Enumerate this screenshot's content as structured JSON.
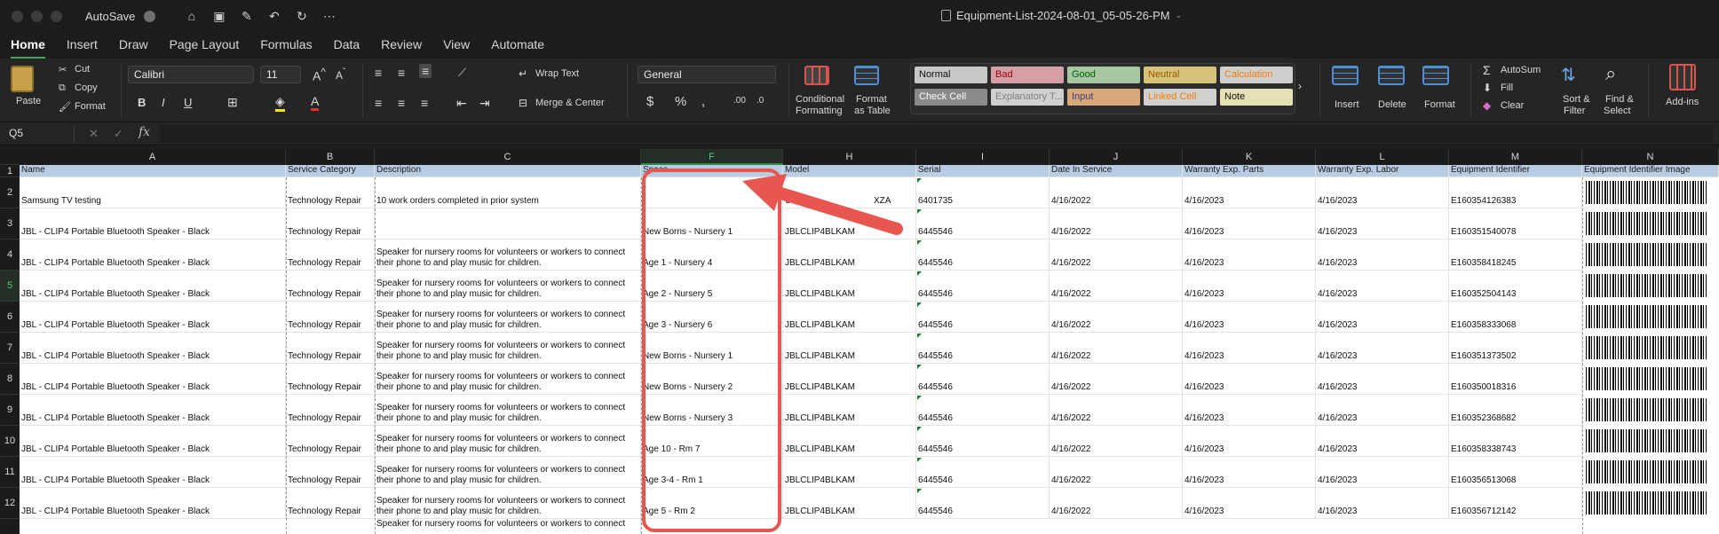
{
  "window": {
    "autosave_label": "AutoSave",
    "title": "Equipment-List-2024-08-01_05-05-26-PM",
    "qat_icons": [
      "home-icon",
      "save-icon",
      "edit-icon",
      "undo-icon",
      "redo-icon",
      "more-icon"
    ]
  },
  "tabs": [
    "Home",
    "Insert",
    "Draw",
    "Page Layout",
    "Formulas",
    "Data",
    "Review",
    "View",
    "Automate"
  ],
  "ribbon": {
    "paste": "Paste",
    "cut": "Cut",
    "copy": "Copy",
    "format": "Format",
    "font_name": "Calibri",
    "font_size": "11",
    "wrap_text": "Wrap Text",
    "merge_center": "Merge & Center",
    "number_format": "General",
    "conditional_formatting": [
      "Conditional",
      "Formatting"
    ],
    "format_as_table": [
      "Format",
      "as Table"
    ],
    "styles": [
      {
        "label": "Normal",
        "bg": "#c8c8c8",
        "fg": "#111111"
      },
      {
        "label": "Bad",
        "bg": "#d4a0a6",
        "fg": "#9c0006"
      },
      {
        "label": "Good",
        "bg": "#a7c7a3",
        "fg": "#006100"
      },
      {
        "label": "Neutral",
        "bg": "#d7c27a",
        "fg": "#9c5700"
      },
      {
        "label": "Calculation",
        "bg": "#cfcfcf",
        "fg": "#fa7d00"
      },
      {
        "label": "Check Cell",
        "bg": "#8a8a8a",
        "fg": "#ffffff"
      },
      {
        "label": "Explanatory T...",
        "bg": "#d0d0d0",
        "fg": "#7f7f7f"
      },
      {
        "label": "Input",
        "bg": "#d7a97a",
        "fg": "#3f3f76"
      },
      {
        "label": "Linked Cell",
        "bg": "#d0d0d0",
        "fg": "#fa7d00"
      },
      {
        "label": "Note",
        "bg": "#e6e1b5",
        "fg": "#111111"
      }
    ],
    "insert": "Insert",
    "delete": "Delete",
    "format_cells": "Format",
    "autosum": "AutoSum",
    "fill": "Fill",
    "clear": "Clear",
    "sort_filter": [
      "Sort &",
      "Filter"
    ],
    "find_select": [
      "Find &",
      "Select"
    ],
    "addins": "Add-ins"
  },
  "formula_bar": {
    "name_box": "Q5",
    "fx": "fx",
    "value": ""
  },
  "sheet": {
    "columns": [
      "A",
      "B",
      "C",
      "F",
      "H",
      "I",
      "J",
      "K",
      "L",
      "M",
      "N"
    ],
    "selected_column": "F",
    "header_row": [
      "Name",
      "Service Category",
      "Description",
      "Space",
      "Model",
      "Serial",
      "Date In Service",
      "Warranty Exp. Parts",
      "Warranty Exp. Labor",
      "Equipment Identifier",
      "Equipment Identifier Image"
    ],
    "rows": [
      {
        "num": "2",
        "cells": [
          "Samsung TV testing",
          "Technology Repair",
          "10 work orders completed in prior system",
          "",
          "UN55",
          "6401735",
          "4/16/2022",
          "4/16/2023",
          "4/16/2023",
          "E160354126383"
        ],
        "model_tail": "XZA"
      },
      {
        "num": "3",
        "cells": [
          "JBL - CLIP4 Portable Bluetooth Speaker - Black",
          "Technology Repair",
          "",
          "New Borns - Nursery 1",
          "JBLCLIP4BLKAM",
          "6445546",
          "4/16/2022",
          "4/16/2023",
          "4/16/2023",
          "E160351540078"
        ]
      },
      {
        "num": "4",
        "cells": [
          "JBL - CLIP4 Portable Bluetooth Speaker - Black",
          "Technology Repair",
          "Speaker for nursery rooms for volunteers or workers to connect their phone to and play music for children.",
          "Age 1 - Nursery 4",
          "JBLCLIP4BLKAM",
          "6445546",
          "4/16/2022",
          "4/16/2023",
          "4/16/2023",
          "E160358418245"
        ]
      },
      {
        "num": "5",
        "cells": [
          "JBL - CLIP4 Portable Bluetooth Speaker - Black",
          "Technology Repair",
          "Speaker for nursery rooms for volunteers or workers to connect their phone to and play music for children.",
          "Age 2 - Nursery 5",
          "JBLCLIP4BLKAM",
          "6445546",
          "4/16/2022",
          "4/16/2023",
          "4/16/2023",
          "E160352504143"
        ]
      },
      {
        "num": "6",
        "cells": [
          "JBL - CLIP4 Portable Bluetooth Speaker - Black",
          "Technology Repair",
          "Speaker for nursery rooms for volunteers or workers to connect their phone to and play music for children.",
          "Age 3 - Nursery 6",
          "JBLCLIP4BLKAM",
          "6445546",
          "4/16/2022",
          "4/16/2023",
          "4/16/2023",
          "E160358333068"
        ]
      },
      {
        "num": "7",
        "cells": [
          "JBL - CLIP4 Portable Bluetooth Speaker - Black",
          "Technology Repair",
          "Speaker for nursery rooms for volunteers or workers to connect their phone to and play music for children.",
          "New Borns - Nursery 1",
          "JBLCLIP4BLKAM",
          "6445546",
          "4/16/2022",
          "4/16/2023",
          "4/16/2023",
          "E160351373502"
        ]
      },
      {
        "num": "8",
        "cells": [
          "JBL - CLIP4 Portable Bluetooth Speaker - Black",
          "Technology Repair",
          "Speaker for nursery rooms for volunteers or workers to connect their phone to and play music for children.",
          "New Borns - Nursery 2",
          "JBLCLIP4BLKAM",
          "6445546",
          "4/16/2022",
          "4/16/2023",
          "4/16/2023",
          "E160350018316"
        ]
      },
      {
        "num": "9",
        "cells": [
          "JBL - CLIP4 Portable Bluetooth Speaker - Black",
          "Technology Repair",
          "Speaker for nursery rooms for volunteers or workers to connect their phone to and play music for children.",
          "New Borns - Nursery 3",
          "JBLCLIP4BLKAM",
          "6445546",
          "4/16/2022",
          "4/16/2023",
          "4/16/2023",
          "E160352368682"
        ]
      },
      {
        "num": "10",
        "cells": [
          "JBL - CLIP4 Portable Bluetooth Speaker - Black",
          "Technology Repair",
          "Speaker for nursery rooms for volunteers or workers to connect their phone to and play music for children.",
          "Age 10 - Rm 7",
          "JBLCLIP4BLKAM",
          "6445546",
          "4/16/2022",
          "4/16/2023",
          "4/16/2023",
          "E160358338743"
        ]
      },
      {
        "num": "11",
        "cells": [
          "JBL - CLIP4 Portable Bluetooth Speaker - Black",
          "Technology Repair",
          "Speaker for nursery rooms for volunteers or workers to connect their phone to and play music for children.",
          "Age 3-4 - Rm 1",
          "JBLCLIP4BLKAM",
          "6445546",
          "4/16/2022",
          "4/16/2023",
          "4/16/2023",
          "E160356513068"
        ]
      },
      {
        "num": "12",
        "cells": [
          "JBL - CLIP4 Portable Bluetooth Speaker - Black",
          "Technology Repair",
          "Speaker for nursery rooms for volunteers or workers to connect their phone to and play music for children.",
          "Age 5 - Rm 2",
          "JBLCLIP4BLKAM",
          "6445546",
          "4/16/2022",
          "4/16/2023",
          "4/16/2023",
          "E160356712142"
        ]
      }
    ],
    "partial_row_text": "Speaker for nursery rooms for volunteers or workers to connect"
  },
  "annotation": {
    "color": "#e8574f"
  }
}
